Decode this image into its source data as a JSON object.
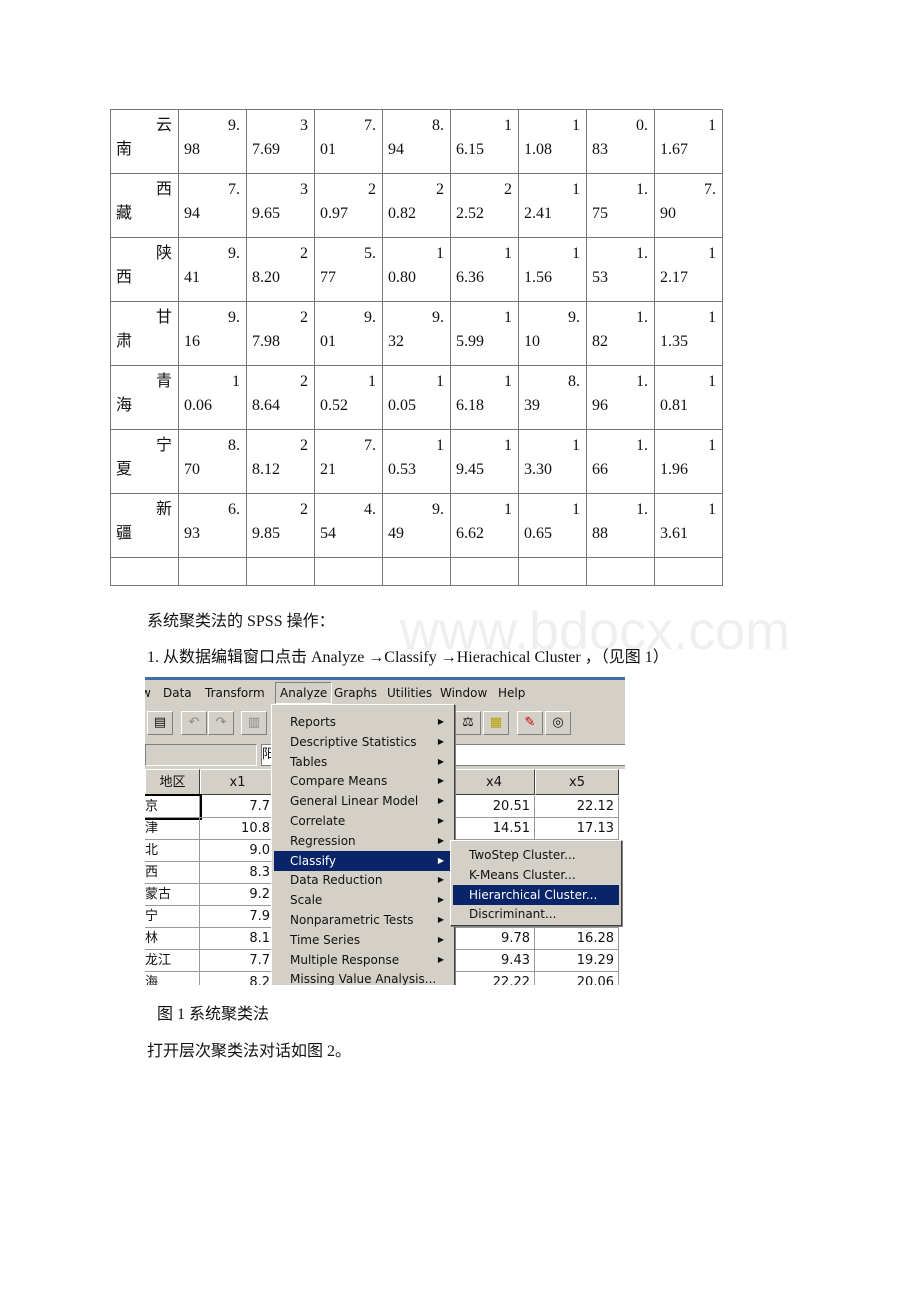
{
  "table": {
    "rows": [
      {
        "region": "云南",
        "values": [
          "9.98",
          "37.69",
          "7.01",
          "8.94",
          "16.15",
          "11.08",
          "0.83",
          "11.67"
        ]
      },
      {
        "region": "西藏",
        "values": [
          "7.94",
          "39.65",
          "20.97",
          "20.82",
          "22.52",
          "12.41",
          "1.75",
          "7.90"
        ]
      },
      {
        "region": "陕西",
        "values": [
          "9.41",
          "28.20",
          "5.77",
          "10.80",
          "16.36",
          "11.56",
          "1.53",
          "12.17"
        ]
      },
      {
        "region": "甘肃",
        "values": [
          "9.16",
          "27.98",
          "9.01",
          "9.32",
          "15.99",
          "9.10",
          "1.82",
          "11.35"
        ]
      },
      {
        "region": "青海",
        "values": [
          "10.06",
          "28.64",
          "10.52",
          "10.05",
          "16.18",
          "8.39",
          "1.96",
          "10.81"
        ]
      },
      {
        "region": "宁夏",
        "values": [
          "8.70",
          "28.12",
          "7.21",
          "10.53",
          "19.45",
          "13.30",
          "1.66",
          "11.96"
        ]
      },
      {
        "region": "新疆",
        "values": [
          "6.93",
          "29.85",
          "4.54",
          "9.49",
          "16.62",
          "10.65",
          "1.88",
          "13.61"
        ]
      }
    ]
  },
  "text": {
    "heading": "系统聚类法的 SPSS 操作：",
    "step1": "1. 从数据编辑窗口点击 Analyze →Classify →Hierachical Cluster ，（见图 1）",
    "caption": "图 1 系统聚类法",
    "after": "打开层次聚类法对话如图 2。",
    "watermark": "www.bdocx.com"
  },
  "spss": {
    "menubar": [
      "w",
      "Data",
      "Transform",
      "Analyze",
      "Graphs",
      "Utilities",
      "Window",
      "Help"
    ],
    "active_menu": "Analyze",
    "formula_char": "阳",
    "headers": {
      "region": "地区",
      "x1": "x1",
      "x4": "x4",
      "x5": "x5"
    },
    "rows": [
      {
        "region": "京",
        "x1": "7.7",
        "x4": "20.51",
        "x5": "22.12"
      },
      {
        "region": "津",
        "x1": "10.8",
        "x4": "14.51",
        "x5": "17.13"
      },
      {
        "region": "北",
        "x1": "9.0",
        "x4": "",
        "x5": ""
      },
      {
        "region": "西",
        "x1": "8.3",
        "x4": "",
        "x5": ""
      },
      {
        "region": "蒙古",
        "x1": "9.2",
        "x4": "",
        "x5": ""
      },
      {
        "region": "宁",
        "x1": "7.9",
        "x4": "",
        "x5": ""
      },
      {
        "region": "林",
        "x1": "8.1",
        "x4": "9.78",
        "x5": "16.28"
      },
      {
        "region": "龙江",
        "x1": "7.7",
        "x4": "9.43",
        "x5": "19.29"
      },
      {
        "region": "海",
        "x1": "8.2",
        "x4": "22.22",
        "x5": "20.06"
      }
    ],
    "analyze_items": [
      "Reports",
      "Descriptive Statistics",
      "Tables",
      "Compare Means",
      "General Linear Model",
      "Correlate",
      "Regression",
      "Classify",
      "Data Reduction",
      "Scale",
      "Nonparametric Tests",
      "Time Series",
      "Multiple Response",
      "Missing Value Analysis..."
    ],
    "analyze_has_submenu": [
      true,
      true,
      true,
      true,
      true,
      true,
      true,
      true,
      true,
      true,
      true,
      true,
      true,
      false
    ],
    "highlighted_item": "Classify",
    "classify_items": [
      "TwoStep Cluster...",
      "K-Means Cluster...",
      "Hierarchical Cluster...",
      "Discriminant..."
    ],
    "highlighted_subitem": "Hierarchical Cluster...",
    "highlight_color": "#0a246a"
  }
}
